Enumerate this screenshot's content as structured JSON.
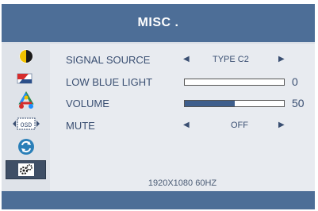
{
  "header": {
    "title": "MISC ."
  },
  "sidebar": {
    "items": [
      {
        "icon": "contrast-icon"
      },
      {
        "icon": "image-flag-icon"
      },
      {
        "icon": "color-icon"
      },
      {
        "icon": "osd-icon",
        "label": "OSD"
      },
      {
        "icon": "reset-icon"
      },
      {
        "icon": "settings-icon",
        "selected": true
      }
    ]
  },
  "settings": {
    "signal_source": {
      "label": "SIGNAL SOURCE",
      "value": "TYPE  C2"
    },
    "low_blue_light": {
      "label": "LOW BLUE LIGHT",
      "value": "0",
      "level": 0
    },
    "volume": {
      "label": "VOLUME",
      "value": "50",
      "level": 50
    },
    "mute": {
      "label": "MUTE",
      "value": "OFF"
    }
  },
  "status": {
    "resolution": "1920X1080  60HZ"
  },
  "colors": {
    "header": "#4d6e97",
    "panel": "#e8ebf0",
    "sidebar_selected": "#3f4f66",
    "bar_fill": "#3e5e8c",
    "text": "#3a4f72"
  }
}
